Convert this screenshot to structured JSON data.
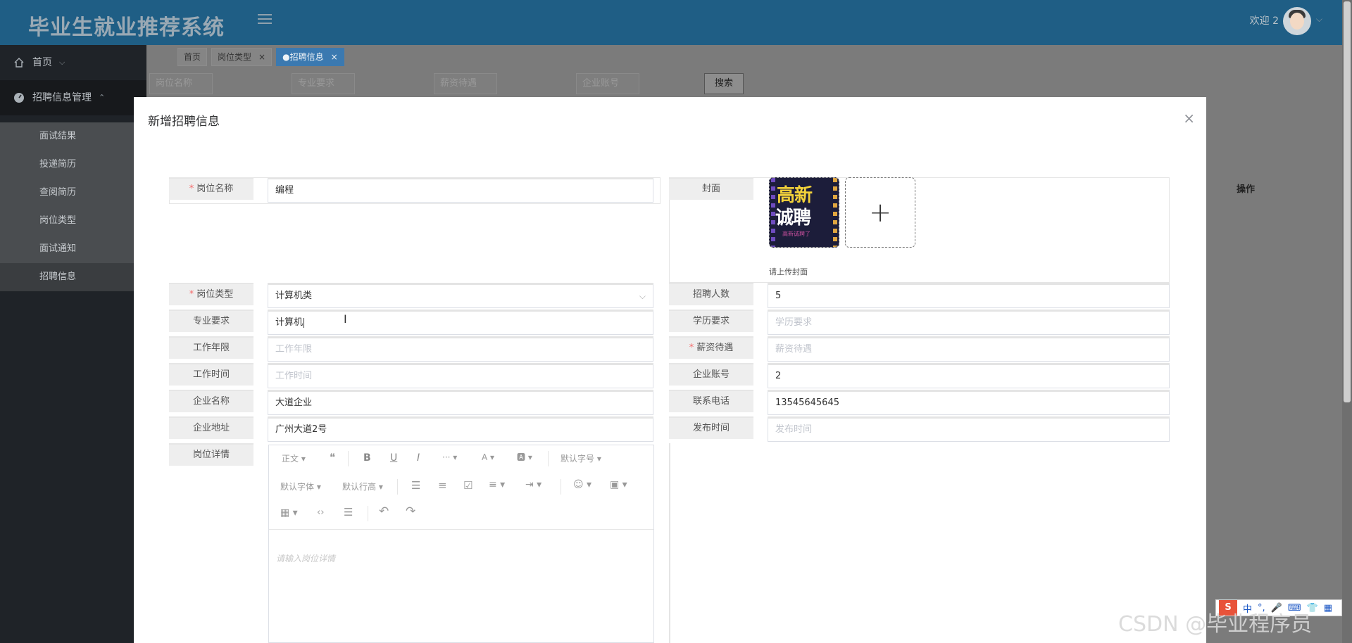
{
  "header": {
    "app_title": "毕业生就业推荐系统",
    "welcome": "欢迎 2"
  },
  "sidebar": {
    "home": "首页",
    "group": "招聘信息管理",
    "items": [
      {
        "label": "面试结果"
      },
      {
        "label": "投递简历"
      },
      {
        "label": "查阅简历"
      },
      {
        "label": "岗位类型"
      },
      {
        "label": "面试通知"
      },
      {
        "label": "招聘信息"
      }
    ]
  },
  "tabs": [
    {
      "label": "首页"
    },
    {
      "label": "岗位类型"
    },
    {
      "label": "●招聘信息"
    }
  ],
  "search": {
    "job_name": "岗位名称",
    "major": "专业要求",
    "salary": "薪资待遇",
    "company_account": "企业账号",
    "button": "搜索"
  },
  "table": {
    "op_header": "操作"
  },
  "modal": {
    "title": "新增招聘信息",
    "close": "×"
  },
  "form": {
    "job_name": {
      "label": "岗位名称",
      "value": "编程"
    },
    "cover": {
      "label": "封面",
      "tip": "请上传封面",
      "img_line1": "高新",
      "img_line2": "诚聘",
      "img_line3": "高新诚聘了"
    },
    "job_type": {
      "label": "岗位类型",
      "value": "计算机类"
    },
    "headcount": {
      "label": "招聘人数",
      "value": "5"
    },
    "major": {
      "label": "专业要求",
      "value": "计算机"
    },
    "education": {
      "label": "学历要求",
      "placeholder": "学历要求"
    },
    "work_years": {
      "label": "工作年限",
      "placeholder": "工作年限"
    },
    "salary": {
      "label": "薪资待遇",
      "placeholder": "薪资待遇"
    },
    "work_time": {
      "label": "工作时间",
      "placeholder": "工作时间"
    },
    "company_account": {
      "label": "企业账号",
      "value": "2"
    },
    "company_name": {
      "label": "企业名称",
      "value": "大道企业"
    },
    "phone": {
      "label": "联系电话",
      "value": "13545645645"
    },
    "company_address": {
      "label": "企业地址",
      "value": "广州大道2号"
    },
    "publish_time": {
      "label": "发布时间",
      "placeholder": "发布时间"
    },
    "job_detail": {
      "label": "岗位详情",
      "placeholder": "请输入岗位详情"
    }
  },
  "editor_toolbar": {
    "paragraph": "正文 ▾",
    "quote": "❝",
    "bold": "B",
    "underline": "U",
    "italic": "I",
    "more": "··· ▾",
    "font_color": "A ▾",
    "bg_color": "🅰 ▾",
    "font_size": "默认字号 ▾",
    "font_family": "默认字体 ▾",
    "line_height": "默认行高 ▾",
    "bullet_list": "☰",
    "numbered_list": "≡",
    "todo": "☑",
    "align": "≡ ▾",
    "indent": "⇥ ▾",
    "emoji": "☺ ▾",
    "image": "▣ ▾",
    "table": "▦ ▾",
    "code": "‹›",
    "divider": "☰",
    "undo": "↶",
    "redo": "↷"
  },
  "ime": {
    "s": "S",
    "lang": "中"
  },
  "watermark": "CSDN @毕业程序员"
}
